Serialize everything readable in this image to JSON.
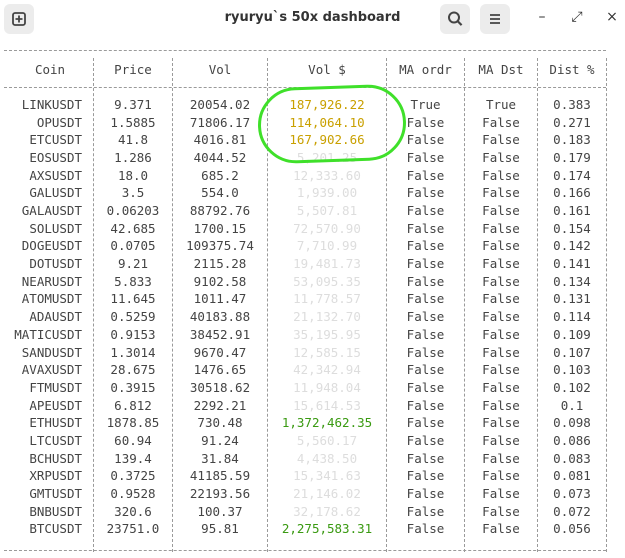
{
  "window": {
    "title": "ryuryu`s 50x dashboard",
    "minimize": "–",
    "maximize": "⤢",
    "close": "×"
  },
  "icons": {
    "new_tab": "new-tab-icon",
    "search": "search-icon",
    "menu": "hamburger-menu-icon"
  },
  "colors": {
    "highlight": "#c9a000",
    "big_volume": "#3a9a12",
    "annotation": "#3fe02a",
    "faded": "#dddddd"
  },
  "columns": [
    "Coin",
    "Price",
    "Vol",
    "Vol $",
    "MA ordr",
    "MA Dst",
    "Dist %"
  ],
  "rows": [
    {
      "coin": "LINKUSDT",
      "price": "9.371",
      "vol": "20054.02",
      "vol_usd": "187,926.22",
      "ma_ordr": "True",
      "ma_dst": "True",
      "dist": "0.383",
      "tone": "yellow"
    },
    {
      "coin": "OPUSDT",
      "price": "1.5885",
      "vol": "71806.17",
      "vol_usd": "114,064.10",
      "ma_ordr": "False",
      "ma_dst": "False",
      "dist": "0.271",
      "tone": "yellow"
    },
    {
      "coin": "ETCUSDT",
      "price": "41.8",
      "vol": "4016.81",
      "vol_usd": "167,902.66",
      "ma_ordr": "False",
      "ma_dst": "False",
      "dist": "0.183",
      "tone": "yellow"
    },
    {
      "coin": "EOSUSDT",
      "price": "1.286",
      "vol": "4044.52",
      "vol_usd": "5,201.25",
      "ma_ordr": "False",
      "ma_dst": "False",
      "dist": "0.179",
      "tone": "faint"
    },
    {
      "coin": "AXSUSDT",
      "price": "18.0",
      "vol": "685.2",
      "vol_usd": "12,333.60",
      "ma_ordr": "False",
      "ma_dst": "False",
      "dist": "0.174",
      "tone": "faint"
    },
    {
      "coin": "GALUSDT",
      "price": "3.5",
      "vol": "554.0",
      "vol_usd": "1,939.00",
      "ma_ordr": "False",
      "ma_dst": "False",
      "dist": "0.166",
      "tone": "faint"
    },
    {
      "coin": "GALAUSDT",
      "price": "0.06203",
      "vol": "88792.76",
      "vol_usd": "5,507.81",
      "ma_ordr": "False",
      "ma_dst": "False",
      "dist": "0.161",
      "tone": "faint"
    },
    {
      "coin": "SOLUSDT",
      "price": "42.685",
      "vol": "1700.15",
      "vol_usd": "72,570.90",
      "ma_ordr": "False",
      "ma_dst": "False",
      "dist": "0.154",
      "tone": "faint"
    },
    {
      "coin": "DOGEUSDT",
      "price": "0.0705",
      "vol": "109375.74",
      "vol_usd": "7,710.99",
      "ma_ordr": "False",
      "ma_dst": "False",
      "dist": "0.142",
      "tone": "faint"
    },
    {
      "coin": "DOTUSDT",
      "price": "9.21",
      "vol": "2115.28",
      "vol_usd": "19,481.73",
      "ma_ordr": "False",
      "ma_dst": "False",
      "dist": "0.141",
      "tone": "faint"
    },
    {
      "coin": "NEARUSDT",
      "price": "5.833",
      "vol": "9102.58",
      "vol_usd": "53,095.35",
      "ma_ordr": "False",
      "ma_dst": "False",
      "dist": "0.134",
      "tone": "faint"
    },
    {
      "coin": "ATOMUSDT",
      "price": "11.645",
      "vol": "1011.47",
      "vol_usd": "11,778.57",
      "ma_ordr": "False",
      "ma_dst": "False",
      "dist": "0.131",
      "tone": "faint"
    },
    {
      "coin": "ADAUSDT",
      "price": "0.5259",
      "vol": "40183.88",
      "vol_usd": "21,132.70",
      "ma_ordr": "False",
      "ma_dst": "False",
      "dist": "0.114",
      "tone": "faint"
    },
    {
      "coin": "MATICUSDT",
      "price": "0.9153",
      "vol": "38452.91",
      "vol_usd": "35,195.95",
      "ma_ordr": "False",
      "ma_dst": "False",
      "dist": "0.109",
      "tone": "faint"
    },
    {
      "coin": "SANDUSDT",
      "price": "1.3014",
      "vol": "9670.47",
      "vol_usd": "12,585.15",
      "ma_ordr": "False",
      "ma_dst": "False",
      "dist": "0.107",
      "tone": "faint"
    },
    {
      "coin": "AVAXUSDT",
      "price": "28.675",
      "vol": "1476.65",
      "vol_usd": "42,342.94",
      "ma_ordr": "False",
      "ma_dst": "False",
      "dist": "0.103",
      "tone": "faint"
    },
    {
      "coin": "FTMUSDT",
      "price": "0.3915",
      "vol": "30518.62",
      "vol_usd": "11,948.04",
      "ma_ordr": "False",
      "ma_dst": "False",
      "dist": "0.102",
      "tone": "faint"
    },
    {
      "coin": "APEUSDT",
      "price": "6.812",
      "vol": "2292.21",
      "vol_usd": "15,614.53",
      "ma_ordr": "False",
      "ma_dst": "False",
      "dist": "0.1",
      "tone": "faint"
    },
    {
      "coin": "ETHUSDT",
      "price": "1878.85",
      "vol": "730.48",
      "vol_usd": "1,372,462.35",
      "ma_ordr": "False",
      "ma_dst": "False",
      "dist": "0.098",
      "tone": "green"
    },
    {
      "coin": "LTCUSDT",
      "price": "60.94",
      "vol": "91.24",
      "vol_usd": "5,560.17",
      "ma_ordr": "False",
      "ma_dst": "False",
      "dist": "0.086",
      "tone": "faint"
    },
    {
      "coin": "BCHUSDT",
      "price": "139.4",
      "vol": "31.84",
      "vol_usd": "4,438.50",
      "ma_ordr": "False",
      "ma_dst": "False",
      "dist": "0.083",
      "tone": "faint"
    },
    {
      "coin": "XRPUSDT",
      "price": "0.3725",
      "vol": "41185.59",
      "vol_usd": "15,341.63",
      "ma_ordr": "False",
      "ma_dst": "False",
      "dist": "0.081",
      "tone": "faint"
    },
    {
      "coin": "GMTUSDT",
      "price": "0.9528",
      "vol": "22193.56",
      "vol_usd": "21,146.02",
      "ma_ordr": "False",
      "ma_dst": "False",
      "dist": "0.073",
      "tone": "faint"
    },
    {
      "coin": "BNBUSDT",
      "price": "320.6",
      "vol": "100.37",
      "vol_usd": "32,178.62",
      "ma_ordr": "False",
      "ma_dst": "False",
      "dist": "0.072",
      "tone": "faint"
    },
    {
      "coin": "BTCUSDT",
      "price": "23751.0",
      "vol": "95.81",
      "vol_usd": "2,275,583.31",
      "ma_ordr": "False",
      "ma_dst": "False",
      "dist": "0.056",
      "tone": "green"
    }
  ]
}
